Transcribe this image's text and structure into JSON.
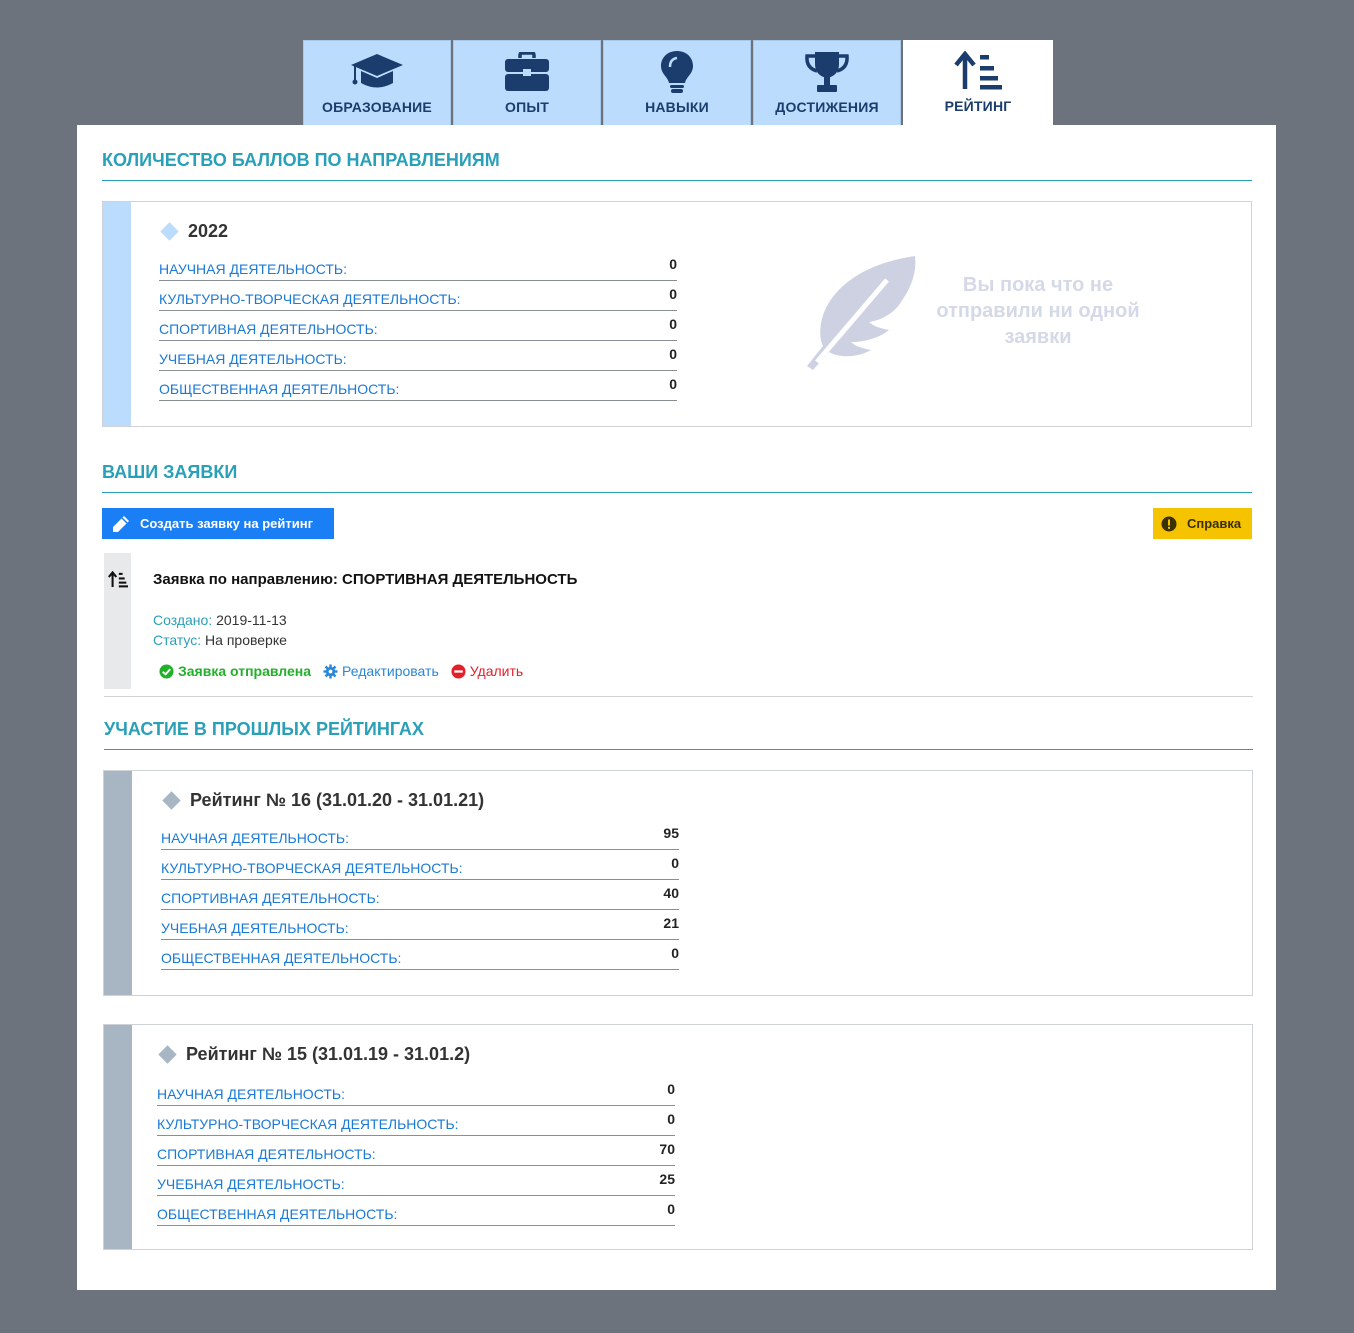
{
  "tabs": [
    {
      "label": "ОБРАЗОВАНИЕ",
      "icon": "graduation-cap-icon"
    },
    {
      "label": "ОПЫТ",
      "icon": "briefcase-icon"
    },
    {
      "label": "НАВЫКИ",
      "icon": "lightbulb-icon"
    },
    {
      "label": "ДОСТИЖЕНИЯ",
      "icon": "trophy-icon"
    },
    {
      "label": "РЕЙТИНГ",
      "icon": "sort-amount-up-icon",
      "active": true
    }
  ],
  "scores": {
    "title": "КОЛИЧЕСТВО БАЛЛОВ ПО НАПРАВЛЕНИЯМ",
    "year": "2022",
    "rows": [
      {
        "label": "НАУЧНАЯ ДЕЯТЕЛЬНОСТЬ:",
        "value": "0"
      },
      {
        "label": "КУЛЬТУРНО-ТВОРЧЕСКАЯ ДЕЯТЕЛЬНОСТЬ:",
        "value": "0"
      },
      {
        "label": "СПОРТИВНАЯ ДЕЯТЕЛЬНОСТЬ:",
        "value": "0"
      },
      {
        "label": "УЧЕБНАЯ ДЕЯТЕЛЬНОСТЬ:",
        "value": "0"
      },
      {
        "label": "ОБЩЕСТВЕННАЯ ДЕЯТЕЛЬНОСТЬ:",
        "value": "0"
      }
    ],
    "empty_text": "Вы пока что не отправили ни одной заявки"
  },
  "applications": {
    "title": "ВАШИ ЗАЯВКИ",
    "create_label": "Создать заявку на рейтинг",
    "help_label": "Справка",
    "item": {
      "title": "Заявка по направлению: СПОРТИВНАЯ ДЕЯТЕЛЬНОСТЬ",
      "created_key": "Создано:",
      "created_value": "2019-11-13",
      "status_key": "Статус:",
      "status_value": "На проверке",
      "sent_label": "Заявка отправлена",
      "edit_label": "Редактировать",
      "delete_label": "Удалить"
    }
  },
  "past": {
    "title": "УЧАСТИЕ В ПРОШЛЫХ РЕЙТИНГАХ",
    "ratings": [
      {
        "title": "Рейтинг № 16 (31.01.20 - 31.01.21)",
        "rows": [
          {
            "label": "НАУЧНАЯ ДЕЯТЕЛЬНОСТЬ:",
            "value": "95"
          },
          {
            "label": "КУЛЬТУРНО-ТВОРЧЕСКАЯ ДЕЯТЕЛЬНОСТЬ:",
            "value": "0"
          },
          {
            "label": "СПОРТИВНАЯ ДЕЯТЕЛЬНОСТЬ:",
            "value": "40"
          },
          {
            "label": "УЧЕБНАЯ ДЕЯТЕЛЬНОСТЬ:",
            "value": "21"
          },
          {
            "label": "ОБЩЕСТВЕННАЯ ДЕЯТЕЛЬНОСТЬ:",
            "value": "0"
          }
        ]
      },
      {
        "title": "Рейтинг № 15 (31.01.19 - 31.01.2)",
        "rows": [
          {
            "label": "НАУЧНАЯ ДЕЯТЕЛЬНОСТЬ:",
            "value": "0"
          },
          {
            "label": "КУЛЬТУРНО-ТВОРЧЕСКАЯ ДЕЯТЕЛЬНОСТЬ:",
            "value": "0"
          },
          {
            "label": "СПОРТИВНАЯ ДЕЯТЕЛЬНОСТЬ:",
            "value": "70"
          },
          {
            "label": "УЧЕБНАЯ ДЕЯТЕЛЬНОСТЬ:",
            "value": "25"
          },
          {
            "label": "ОБЩЕСТВЕННАЯ ДЕЯТЕЛЬНОСТЬ:",
            "value": "0"
          }
        ]
      }
    ]
  },
  "colors": {
    "accent": "#2aa0b8",
    "link": "#1a7ad6",
    "tab_bg": "#bcdcfd",
    "tab_text": "#1a3d6e",
    "button_primary": "#1a7ef5",
    "button_help": "#f5c300",
    "success": "#22b02a",
    "danger": "#e3202a"
  }
}
